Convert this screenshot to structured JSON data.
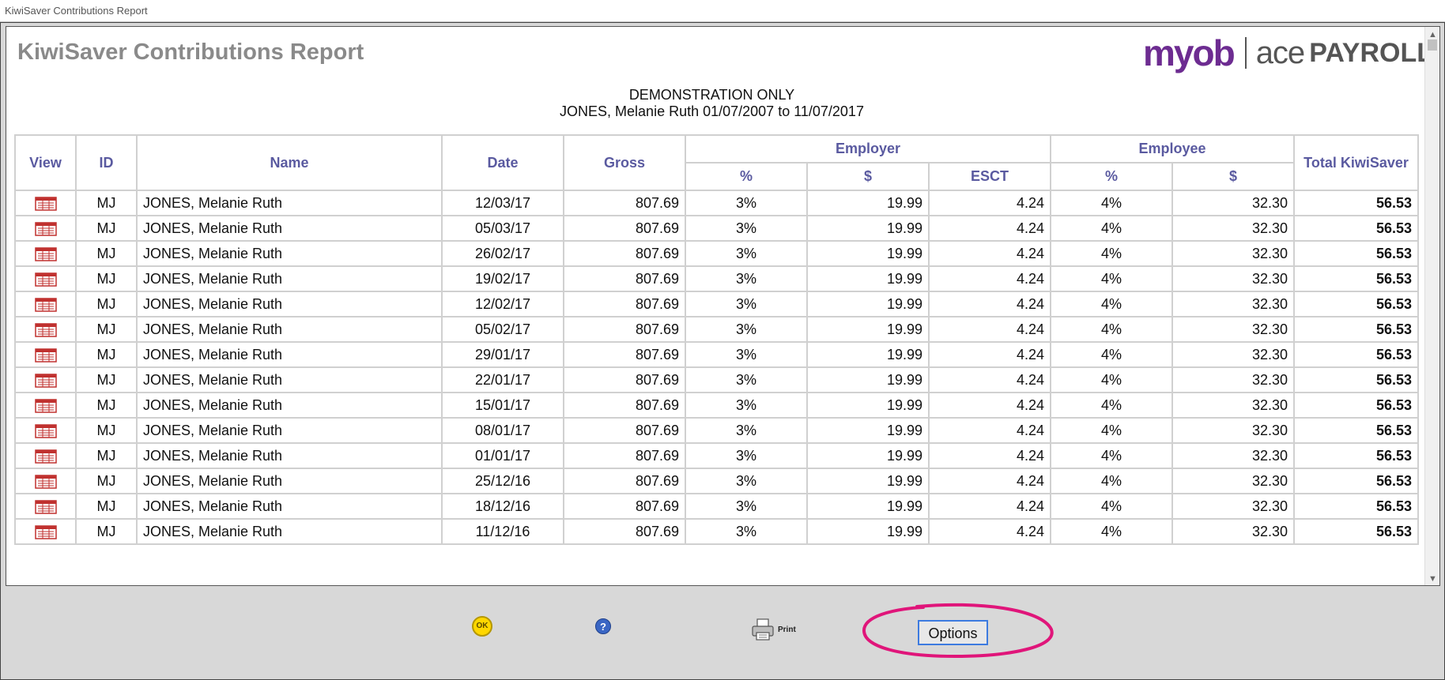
{
  "window": {
    "title": "KiwiSaver Contributions Report"
  },
  "report": {
    "title": "KiwiSaver Contributions Report",
    "logo": {
      "brand": "myob",
      "product_a": "ace",
      "product_b": "PAYROLL",
      "brand_color": "#6d2c91"
    },
    "subtitle_line1": "DEMONSTRATION ONLY",
    "subtitle_line2": "JONES, Melanie Ruth 01/07/2007 to 11/07/2017"
  },
  "table": {
    "headers": {
      "view": "View",
      "id": "ID",
      "name": "Name",
      "date": "Date",
      "gross": "Gross",
      "employer": "Employer",
      "employee": "Employee",
      "total": "Total KiwiSaver",
      "er_pct": "%",
      "er_dollar": "$",
      "esct": "ESCT",
      "ee_pct": "%",
      "ee_dollar": "$"
    },
    "rows": [
      {
        "id": "MJ",
        "name": "JONES, Melanie Ruth",
        "date": "12/03/17",
        "gross": "807.69",
        "er_pct": "3%",
        "er_dollar": "19.99",
        "esct": "4.24",
        "ee_pct": "4%",
        "ee_dollar": "32.30",
        "total": "56.53"
      },
      {
        "id": "MJ",
        "name": "JONES, Melanie Ruth",
        "date": "05/03/17",
        "gross": "807.69",
        "er_pct": "3%",
        "er_dollar": "19.99",
        "esct": "4.24",
        "ee_pct": "4%",
        "ee_dollar": "32.30",
        "total": "56.53"
      },
      {
        "id": "MJ",
        "name": "JONES, Melanie Ruth",
        "date": "26/02/17",
        "gross": "807.69",
        "er_pct": "3%",
        "er_dollar": "19.99",
        "esct": "4.24",
        "ee_pct": "4%",
        "ee_dollar": "32.30",
        "total": "56.53"
      },
      {
        "id": "MJ",
        "name": "JONES, Melanie Ruth",
        "date": "19/02/17",
        "gross": "807.69",
        "er_pct": "3%",
        "er_dollar": "19.99",
        "esct": "4.24",
        "ee_pct": "4%",
        "ee_dollar": "32.30",
        "total": "56.53"
      },
      {
        "id": "MJ",
        "name": "JONES, Melanie Ruth",
        "date": "12/02/17",
        "gross": "807.69",
        "er_pct": "3%",
        "er_dollar": "19.99",
        "esct": "4.24",
        "ee_pct": "4%",
        "ee_dollar": "32.30",
        "total": "56.53"
      },
      {
        "id": "MJ",
        "name": "JONES, Melanie Ruth",
        "date": "05/02/17",
        "gross": "807.69",
        "er_pct": "3%",
        "er_dollar": "19.99",
        "esct": "4.24",
        "ee_pct": "4%",
        "ee_dollar": "32.30",
        "total": "56.53"
      },
      {
        "id": "MJ",
        "name": "JONES, Melanie Ruth",
        "date": "29/01/17",
        "gross": "807.69",
        "er_pct": "3%",
        "er_dollar": "19.99",
        "esct": "4.24",
        "ee_pct": "4%",
        "ee_dollar": "32.30",
        "total": "56.53"
      },
      {
        "id": "MJ",
        "name": "JONES, Melanie Ruth",
        "date": "22/01/17",
        "gross": "807.69",
        "er_pct": "3%",
        "er_dollar": "19.99",
        "esct": "4.24",
        "ee_pct": "4%",
        "ee_dollar": "32.30",
        "total": "56.53"
      },
      {
        "id": "MJ",
        "name": "JONES, Melanie Ruth",
        "date": "15/01/17",
        "gross": "807.69",
        "er_pct": "3%",
        "er_dollar": "19.99",
        "esct": "4.24",
        "ee_pct": "4%",
        "ee_dollar": "32.30",
        "total": "56.53"
      },
      {
        "id": "MJ",
        "name": "JONES, Melanie Ruth",
        "date": "08/01/17",
        "gross": "807.69",
        "er_pct": "3%",
        "er_dollar": "19.99",
        "esct": "4.24",
        "ee_pct": "4%",
        "ee_dollar": "32.30",
        "total": "56.53"
      },
      {
        "id": "MJ",
        "name": "JONES, Melanie Ruth",
        "date": "01/01/17",
        "gross": "807.69",
        "er_pct": "3%",
        "er_dollar": "19.99",
        "esct": "4.24",
        "ee_pct": "4%",
        "ee_dollar": "32.30",
        "total": "56.53"
      },
      {
        "id": "MJ",
        "name": "JONES, Melanie Ruth",
        "date": "25/12/16",
        "gross": "807.69",
        "er_pct": "3%",
        "er_dollar": "19.99",
        "esct": "4.24",
        "ee_pct": "4%",
        "ee_dollar": "32.30",
        "total": "56.53"
      },
      {
        "id": "MJ",
        "name": "JONES, Melanie Ruth",
        "date": "18/12/16",
        "gross": "807.69",
        "er_pct": "3%",
        "er_dollar": "19.99",
        "esct": "4.24",
        "ee_pct": "4%",
        "ee_dollar": "32.30",
        "total": "56.53"
      },
      {
        "id": "MJ",
        "name": "JONES, Melanie Ruth",
        "date": "11/12/16",
        "gross": "807.69",
        "er_pct": "3%",
        "er_dollar": "19.99",
        "esct": "4.24",
        "ee_pct": "4%",
        "ee_dollar": "32.30",
        "total": "56.53"
      }
    ],
    "view_icon": "report-view-icon",
    "header_color": "#5a5aa0"
  },
  "toolbar": {
    "ok_label": "OK",
    "help_label": "?",
    "print_label": "Print",
    "options_label": "Options",
    "highlight_color": "#e0157a"
  }
}
